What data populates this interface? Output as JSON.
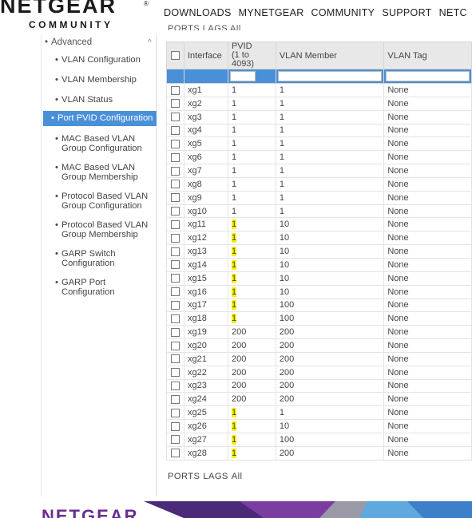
{
  "header": {
    "logo": "NETGEAR",
    "logo_reg": "®",
    "community": "COMMUNITY",
    "nav": [
      "DOWNLOADS",
      "MYNETGEAR",
      "COMMUNITY",
      "SUPPORT",
      "NETC"
    ]
  },
  "sidebar": {
    "section": "Advanced",
    "caret": "^",
    "items": [
      {
        "label": "VLAN Configuration"
      },
      {
        "label": "VLAN Membership"
      },
      {
        "label": "VLAN Status"
      },
      {
        "label": "Port PVID Configuration",
        "active": true
      },
      {
        "label": "MAC Based VLAN",
        "label2": "Group Configuration"
      },
      {
        "label": "MAC Based VLAN",
        "label2": "Group Membership"
      },
      {
        "label": "Protocol Based VLAN",
        "label2": "Group Configuration"
      },
      {
        "label": "Protocol Based VLAN",
        "label2": "Group Membership"
      },
      {
        "label": "GARP Switch",
        "label2": "Configuration"
      },
      {
        "label": "GARP Port",
        "label2": "Configuration"
      }
    ]
  },
  "main": {
    "top_links": "PORTS LAGS All",
    "columns": [
      "Interface",
      "PVID\n(1 to 4093)",
      "VLAN Member",
      "VLAN Tag"
    ],
    "rows": [
      {
        "iface": "xg1",
        "pvid": "1",
        "member": "1",
        "tag": "None"
      },
      {
        "iface": "xg2",
        "pvid": "1",
        "member": "1",
        "tag": "None"
      },
      {
        "iface": "xg3",
        "pvid": "1",
        "member": "1",
        "tag": "None"
      },
      {
        "iface": "xg4",
        "pvid": "1",
        "member": "1",
        "tag": "None"
      },
      {
        "iface": "xg5",
        "pvid": "1",
        "member": "1",
        "tag": "None"
      },
      {
        "iface": "xg6",
        "pvid": "1",
        "member": "1",
        "tag": "None"
      },
      {
        "iface": "xg7",
        "pvid": "1",
        "member": "1",
        "tag": "None"
      },
      {
        "iface": "xg8",
        "pvid": "1",
        "member": "1",
        "tag": "None"
      },
      {
        "iface": "xg9",
        "pvid": "1",
        "member": "1",
        "tag": "None"
      },
      {
        "iface": "xg10",
        "pvid": "1",
        "member": "1",
        "tag": "None"
      },
      {
        "iface": "xg11",
        "pvid": "1",
        "member": "10",
        "tag": "None",
        "hl": true
      },
      {
        "iface": "xg12",
        "pvid": "1",
        "member": "10",
        "tag": "None",
        "hl": true
      },
      {
        "iface": "xg13",
        "pvid": "1",
        "member": "10",
        "tag": "None",
        "hl": true
      },
      {
        "iface": "xg14",
        "pvid": "1",
        "member": "10",
        "tag": "None",
        "hl": true
      },
      {
        "iface": "xg15",
        "pvid": "1",
        "member": "10",
        "tag": "None",
        "hl": true
      },
      {
        "iface": "xg16",
        "pvid": "1",
        "member": "10",
        "tag": "None",
        "hl": true
      },
      {
        "iface": "xg17",
        "pvid": "1",
        "member": "100",
        "tag": "None",
        "hl": true
      },
      {
        "iface": "xg18",
        "pvid": "1",
        "member": "100",
        "tag": "None",
        "hl": true
      },
      {
        "iface": "xg19",
        "pvid": "200",
        "member": "200",
        "tag": "None"
      },
      {
        "iface": "xg20",
        "pvid": "200",
        "member": "200",
        "tag": "None"
      },
      {
        "iface": "xg21",
        "pvid": "200",
        "member": "200",
        "tag": "None"
      },
      {
        "iface": "xg22",
        "pvid": "200",
        "member": "200",
        "tag": "None"
      },
      {
        "iface": "xg23",
        "pvid": "200",
        "member": "200",
        "tag": "None"
      },
      {
        "iface": "xg24",
        "pvid": "200",
        "member": "200",
        "tag": "None"
      },
      {
        "iface": "xg25",
        "pvid": "1",
        "member": "1",
        "tag": "None",
        "hl": true
      },
      {
        "iface": "xg26",
        "pvid": "1",
        "member": "10",
        "tag": "None",
        "hl": true
      },
      {
        "iface": "xg27",
        "pvid": "1",
        "member": "100",
        "tag": "None",
        "hl": true
      },
      {
        "iface": "xg28",
        "pvid": "1",
        "member": "200",
        "tag": "None",
        "hl": true
      }
    ],
    "bottom_links": [
      "PORTS",
      "LAGS",
      "All"
    ]
  },
  "footer": {
    "logo": "NETGEAR"
  },
  "colors": {
    "accent": "#4a90d9",
    "highlight": "#f5f200",
    "brand_purple": "#6a2c91"
  }
}
